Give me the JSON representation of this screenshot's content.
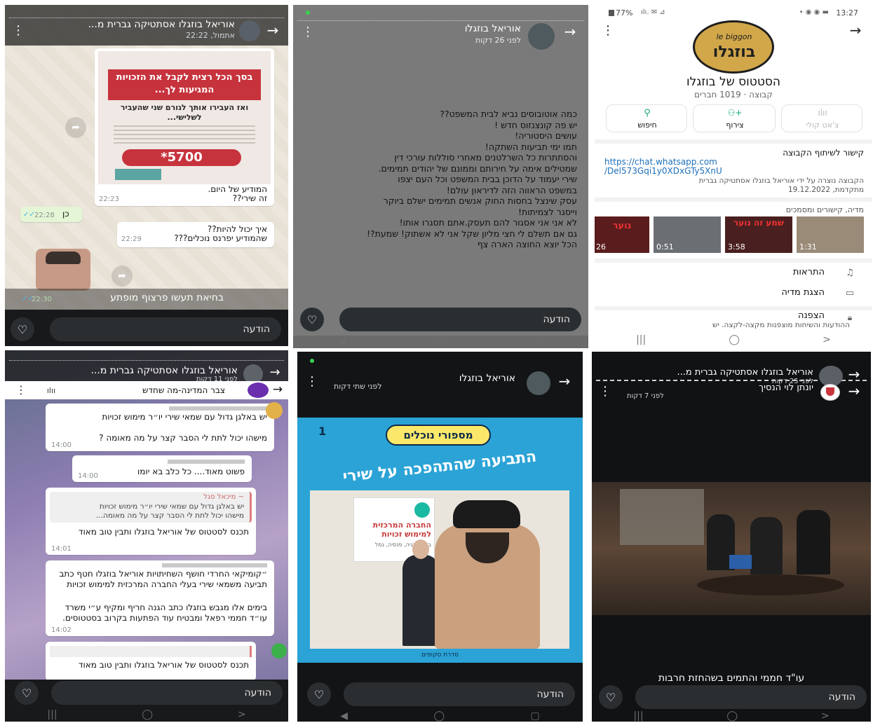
{
  "p1": {
    "title": "אוריאל בוזגלו אסתטיקה גברית מ...",
    "subtitle": "אתמול, 22:22",
    "flyer_h1": "בסך הכל רצית לקבל את הזכויות המגיעות לך...",
    "flyer_h2": "ואז העבירו אותך לגורם שני שהעביר לשלישי...",
    "flyer_price": "*5700",
    "msg1": "המודיע של היום.",
    "msg1b": "זה שירי??",
    "msg1_time": "22:23",
    "msg2": "כן",
    "msg2_time": "22:28",
    "msg3": "איך יכול להיות??",
    "msg3b": "שהמודיע יפרנס נוכלים???",
    "msg3_time": "22:29",
    "caption": "בחיאת תעשו פרצוף מופתע",
    "caption_time": "22:30",
    "reply": "הודעה"
  },
  "p2": {
    "title": "אוריאל בוזגלו",
    "subtitle": "לפני 26 דקות",
    "lines": [
      "כמה אוטובוסים נביא לבית המשפט??",
      "יש פה קונצנזוס חדש !",
      "עושים היסטוריה!",
      "תמו ימי תביעות השתקה!",
      "והסתתרות כל השרלטנים מאחרי סוללות עורכי דין",
      "שמטילים אימה על חירותם וממונם של יהודים תמימים.",
      "שירי יעמוד על הדוכן בבית המשפט וכל העם יצפו",
      "במשפט הראווה הזה לדיראון עולם!",
      "עסק שינצל בחסות החוק אנשים תמימים ישלם ביוקר",
      "וייסגר לצמיתות!",
      "לא אני אני אסגור להם תעסק.אתם תסגרו אותו!",
      "גם אם תשלם לי חצי מליון שקל אני לא אשתוק! שמעת?!",
      "הכל יוצא החוצה הארה צף"
    ],
    "reply": "הודעה"
  },
  "p3": {
    "status_time": "13:27",
    "status_battery": "77%",
    "logo_text": "בוזגלו",
    "logo_top": "le biggon",
    "group_name": "הסטטוס של בוזגלו",
    "group_meta": "קבוצה · 1019 חברים",
    "actions": [
      "חיפוש",
      "צירוף",
      "צ'אט קולי"
    ],
    "share_label": "קישור לשיתוף הקבוצה",
    "link_1": "https://chat.whatsapp.com",
    "link_2": "/Del573Gqi1y0XDxGTy5XnU",
    "created_1": "הקבוצה נוצרה על ידי אוריאל בוזגלו אסתטיקה גברית",
    "created_2": "מתקדמת, 19.12.2022",
    "media_label": "מדיה, קישורים ומסמכים",
    "thumbs": [
      {
        "dur": "1:31",
        "text": ""
      },
      {
        "dur": "3:58",
        "text": "שמע זה נוער"
      },
      {
        "dur": "0:51",
        "text": ""
      },
      {
        "dur": "26",
        "text": "נוער"
      }
    ],
    "settings": [
      "התראות",
      "הצגת מדיה",
      "הצפנה"
    ],
    "encryption_sub": "ההודעות והשיחות מוצפנות מקצה-לקצה. יש"
  },
  "p4": {
    "title": "אוריאל בוזגלו אסתטיקה גברית מ...",
    "subtitle": "לפני 11 דקות",
    "inner_title": "צבר המדינה-מה שחדש",
    "m1a": "יש באלגן גדול עם שמאי שירי יו״ר מימוש זכויות",
    "m1b": "מישהו יכול לתת לי הסבר קצר על מה מאומה ?",
    "m1_time": "14:00",
    "m2": "פשוט מאוד.... כל כלב בא יומו",
    "m2_time": "14:00",
    "m3_quote_name": "~ מיכאל סגל",
    "m3_quote_1": "יש באלגן גדול עם שמאי שירי יו״ר מימוש זכויות",
    "m3_quote_2": "מישהו יכול לתת לי הסבר קצר על מה מאומה...",
    "m3": "תכנס לסטטוס של אוריאל בוזגלו ותבין טוב מאוד",
    "m3_time": "14:01",
    "m4": "״קומיקאי החרדי חושף השחיתויות אוריאל בוזגלו חטף כתב תביעה משמאי שירי בעלי החברה המרכזית למימוש זכויות",
    "m4b": "בימים אלו מגבש בוזגלו כתב הגנה חריף ומקיף ע״י משרד עו״ד חממי רפאל ומבטיח עוד הפתעות בקרוב בסטטוסים.",
    "m4_time": "14:02",
    "m5": "תכנס לסטטוס של אוריאל בוזגלו ותבין טוב מאוד",
    "reply": "הודעה"
  },
  "p5": {
    "title": "אוריאל בוזגלו",
    "subtitle": "לפני שתי דקות",
    "poster_badge": "מספורי נוכלים",
    "poster_number": "1",
    "poster_headline": "התביעה שהתהפכה על שירי",
    "poster_company": "החברה המרכזית למימוש זכויות",
    "poster_company_sub": "ביטוח בניה, פנסיה, גמל",
    "poster_footer": "סדרת סקופים",
    "reply": "הודעה"
  },
  "p6": {
    "title": "אוריאל בוזגלו אסתטיקה גברית מ...",
    "subtitle": "לפני 25 דקות",
    "second_name": "יונתן לוי הנסיך",
    "second_time": "לפני 7 דקות",
    "caption": "עו\"ד חממי והתמים בשהחזת חרבות",
    "reply": "הודעה"
  }
}
